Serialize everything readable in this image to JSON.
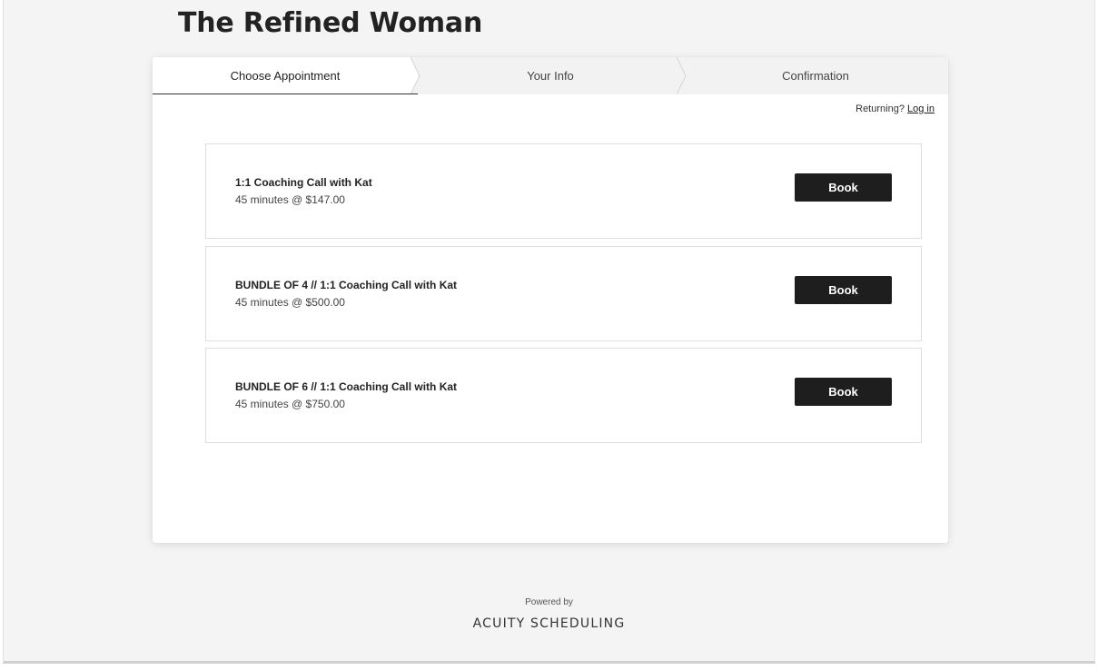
{
  "header": {
    "title": "The Refined Woman"
  },
  "steps": [
    {
      "label": "Choose Appointment",
      "active": true
    },
    {
      "label": "Your Info",
      "active": false
    },
    {
      "label": "Confirmation",
      "active": false
    }
  ],
  "returning": {
    "prefix": "Returning?",
    "login_label": "Log in"
  },
  "appointments": [
    {
      "name": "1:1 Coaching Call with Kat",
      "description": "45 minutes @ $147.00",
      "button_label": "Book"
    },
    {
      "name": "BUNDLE OF 4 // 1:1 Coaching Call with Kat",
      "description": "45 minutes @ $500.00",
      "button_label": "Book"
    },
    {
      "name": "BUNDLE OF 6 // 1:1 Coaching Call with Kat",
      "description": "45 minutes @ $750.00",
      "button_label": "Book"
    }
  ],
  "footer": {
    "powered_by": "Powered by",
    "brand": "ACUITY SCHEDULING"
  },
  "colors": {
    "button_bg": "#1e1e1e",
    "page_bg": "#f4f4f4",
    "card_bg": "#ffffff"
  }
}
